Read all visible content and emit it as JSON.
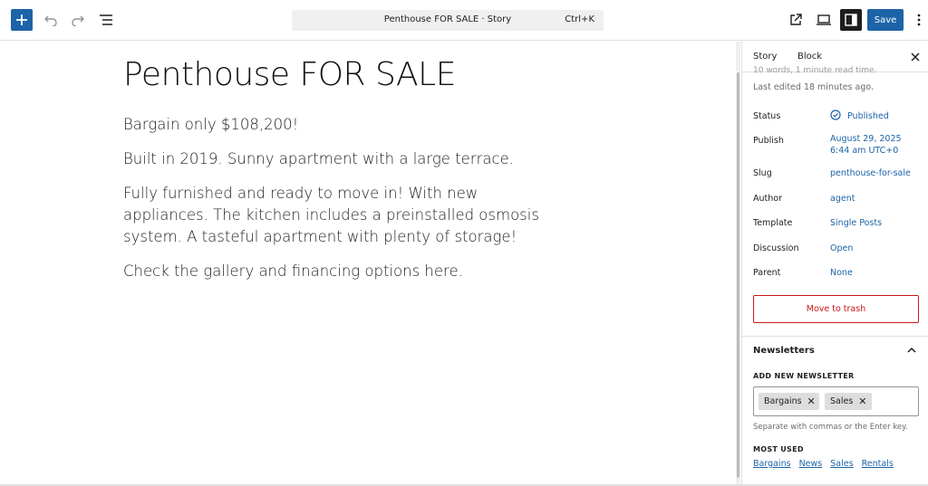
{
  "toolbar": {
    "command_title": "Penthouse FOR SALE · Story",
    "command_shortcut": "Ctrl+K",
    "save_label": "Save",
    "colors": {
      "accent": "#1d63a8",
      "dark": "#1e1e1e"
    }
  },
  "editor": {
    "title": "Penthouse FOR SALE",
    "paragraphs": [
      "Bargain only $108,200!",
      "Built in 2019. Sunny apartment with a large terrace.",
      "Fully furnished and ready to move in! With new appliances. The kitchen includes a preinstalled osmosis system. A tasteful apartment with plenty of storage!",
      "Check the gallery and financing options here."
    ]
  },
  "sidebar": {
    "tabs": [
      "Story",
      "Block"
    ],
    "clipped_text": "10 words, 1 minute read time.",
    "last_edited": "Last edited 18 minutes ago.",
    "meta": [
      {
        "label": "Status",
        "value": "Published"
      },
      {
        "label": "Publish",
        "value": "August 29, 2025",
        "value2": "6:44 am UTC+0"
      },
      {
        "label": "Slug",
        "value": "penthouse-for-sale"
      },
      {
        "label": "Author",
        "value": "agent"
      },
      {
        "label": "Template",
        "value": "Single Posts"
      },
      {
        "label": "Discussion",
        "value": "Open"
      },
      {
        "label": "Parent",
        "value": "None"
      }
    ],
    "trash_label": "Move to trash",
    "newsletters": {
      "title": "Newsletters",
      "add_label": "ADD NEW NEWSLETTER",
      "tokens": [
        "Bargains",
        "Sales"
      ],
      "help": "Separate with commas or the Enter key.",
      "most_used_label": "MOST USED",
      "most_used": [
        "Bargains",
        "News",
        "Sales",
        "Rentals"
      ]
    }
  }
}
